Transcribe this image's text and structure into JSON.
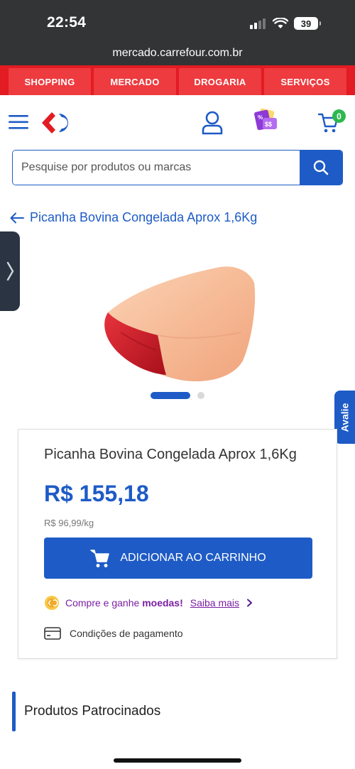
{
  "status_bar": {
    "time": "22:54",
    "battery": "39"
  },
  "browser": {
    "url": "mercado.carrefour.com.br"
  },
  "categories": [
    {
      "label": "SHOPPING"
    },
    {
      "label": "MERCADO"
    },
    {
      "label": "DROGARIA"
    },
    {
      "label": "SERVIÇOS"
    }
  ],
  "header": {
    "cart_count": "0"
  },
  "search": {
    "placeholder": "Pesquise por produtos ou marcas"
  },
  "breadcrumb": {
    "back_label": "Picanha Bovina Congelada Aprox 1,6Kg"
  },
  "side_tab": {
    "label": "Avalie"
  },
  "product": {
    "title": "Picanha Bovina Congelada Aprox 1,6Kg",
    "price": "R$ 155,18",
    "unit_price": "R$ 96,99/kg",
    "add_to_cart": "ADICIONAR AO CARRINHO",
    "coins_text_1": "Compre e ganhe ",
    "coins_text_bold": "moedas!",
    "coins_link": "Saiba mais",
    "payment_label": "Condições de pagamento"
  },
  "sponsored": {
    "title": "Produtos Patrocinados"
  },
  "colors": {
    "brand_blue": "#1e5bc6",
    "brand_red": "#e31b23",
    "coins_purple": "#7b1fa2"
  }
}
